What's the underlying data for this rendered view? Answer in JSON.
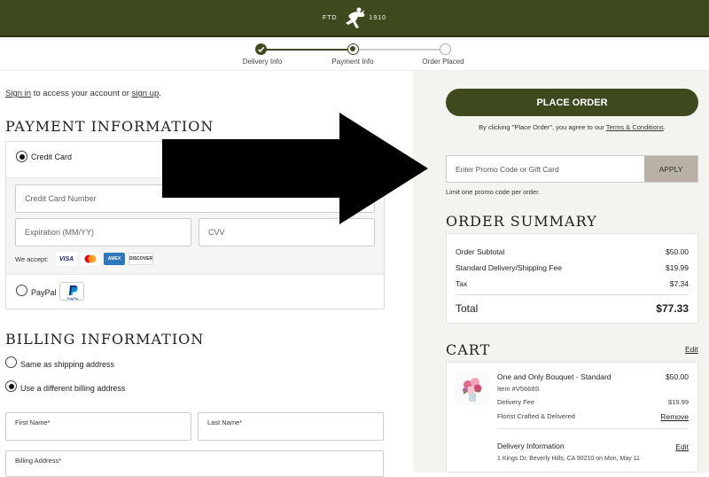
{
  "header": {
    "est": "FTD",
    "year": "1910",
    "logo_icon": "mercury-man-logo-icon"
  },
  "steps": [
    {
      "label": "Delivery Info",
      "state": "done"
    },
    {
      "label": "Payment Info",
      "state": "current"
    },
    {
      "label": "Order Placed",
      "state": "pending"
    }
  ],
  "signin": {
    "link1": "Sign in",
    "mid": " to access your account or ",
    "link2": "sign up",
    "end": "."
  },
  "payment": {
    "title": "PAYMENT INFORMATION",
    "credit_card_label": "Credit Card",
    "cc_number_placeholder": "Credit Card Number",
    "expiration_placeholder": "Expiration (MM/YY)",
    "cvv_placeholder": "CVV",
    "we_accept": "We accept:",
    "cards": [
      "VISA",
      "Mastercard",
      "American Express",
      "DISCOVER"
    ],
    "paypal_label": "PayPal",
    "paypal_badge": "PayPal"
  },
  "billing": {
    "title": "BILLING INFORMATION",
    "same_label": "Same as shipping address",
    "different_label": "Use a different billing address",
    "first_name_label": "First Name*",
    "last_name_label": "Last Name*",
    "address_label": "Billing Address*"
  },
  "order": {
    "place_order_label": "PLACE ORDER",
    "terms_prefix": "By clicking \"Place Order\", you agree to our ",
    "terms_link": "Terms & Conditions",
    "terms_suffix": ".",
    "promo_placeholder": "Enter Promo Code or Gift Card",
    "apply_label": "APPLY",
    "limit_text": "Limit one promo code per order."
  },
  "summary": {
    "title": "ORDER SUMMARY",
    "rows": [
      {
        "label": "Order Subtotal",
        "value": "$50.00"
      },
      {
        "label": "Standard Delivery/Shipping Fee",
        "value": "$19.99"
      },
      {
        "label": "Tax",
        "value": "$7.34"
      }
    ],
    "total_label": "Total",
    "total_value": "$77.33"
  },
  "cart": {
    "title": "CART",
    "edit_label": "Edit",
    "item_name": "One and Only Bouquet - Standard",
    "item_price": "$50.00",
    "item_sku": "Item #V5668S",
    "delivery_fee_label": "Delivery Fee",
    "delivery_fee_value": "$19.99",
    "crafted_label": "Florist Crafted & Delivered",
    "remove_label": "Remove",
    "delivery_info_label": "Delivery Information",
    "delivery_edit_label": "Edit",
    "delivery_address": "1 Kings Dr, Beverly Hills, CA 90210 on Mon, May 11"
  },
  "colors": {
    "brand_green": "#3e4a1e",
    "apply_bg": "#b9b0a6",
    "panel_bg": "#f3f3ef"
  }
}
